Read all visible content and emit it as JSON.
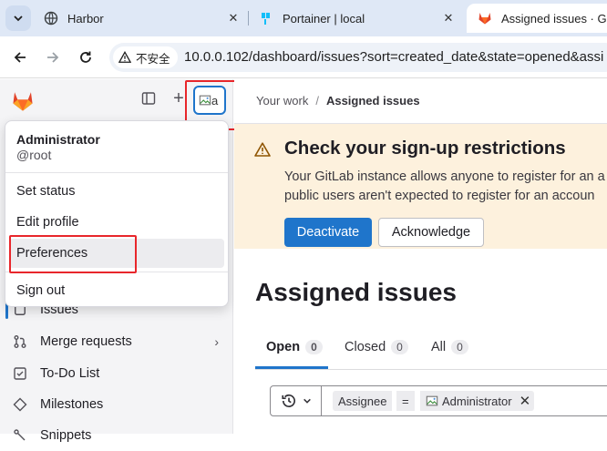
{
  "browser": {
    "tabs": [
      {
        "title": "Harbor",
        "favicon": "harbor-icon"
      },
      {
        "title": "Portainer | local",
        "favicon": "portainer-icon"
      },
      {
        "title": "Assigned issues · Git",
        "favicon": "gitlab-icon",
        "active": true
      }
    ],
    "security_label": "不安全",
    "url": "10.0.0.102/dashboard/issues?sort=created_date&state=opened&assi"
  },
  "user_menu": {
    "name": "Administrator",
    "username": "@root",
    "items": [
      "Set status",
      "Edit profile",
      "Preferences",
      "Sign out"
    ],
    "avatar_alt": "a"
  },
  "sidebar": {
    "items": [
      {
        "label": "Issues",
        "icon": "issues-icon"
      },
      {
        "label": "Merge requests",
        "icon": "merge-request-icon"
      },
      {
        "label": "To-Do List",
        "icon": "todo-icon"
      },
      {
        "label": "Milestones",
        "icon": "milestone-icon"
      },
      {
        "label": "Snippets",
        "icon": "snippet-icon"
      }
    ]
  },
  "breadcrumb": {
    "parent": "Your work",
    "current": "Assigned issues"
  },
  "alert": {
    "title": "Check your sign-up restrictions",
    "body_line1": "Your GitLab instance allows anyone to register for an a",
    "body_line2": "public users aren't expected to register for an accoun",
    "primary_button": "Deactivate",
    "secondary_button": "Acknowledge",
    "background": "#fdf1dd"
  },
  "page": {
    "title": "Assigned issues",
    "tabs": [
      {
        "label": "Open",
        "count": "0"
      },
      {
        "label": "Closed",
        "count": "0"
      },
      {
        "label": "All",
        "count": "0"
      }
    ]
  },
  "filter": {
    "field": "Assignee",
    "operator": "=",
    "value": "Administrator"
  },
  "colors": {
    "accent": "#1f75cb",
    "highlight": "#e8262b",
    "gitlab_orange": "#e24329"
  }
}
